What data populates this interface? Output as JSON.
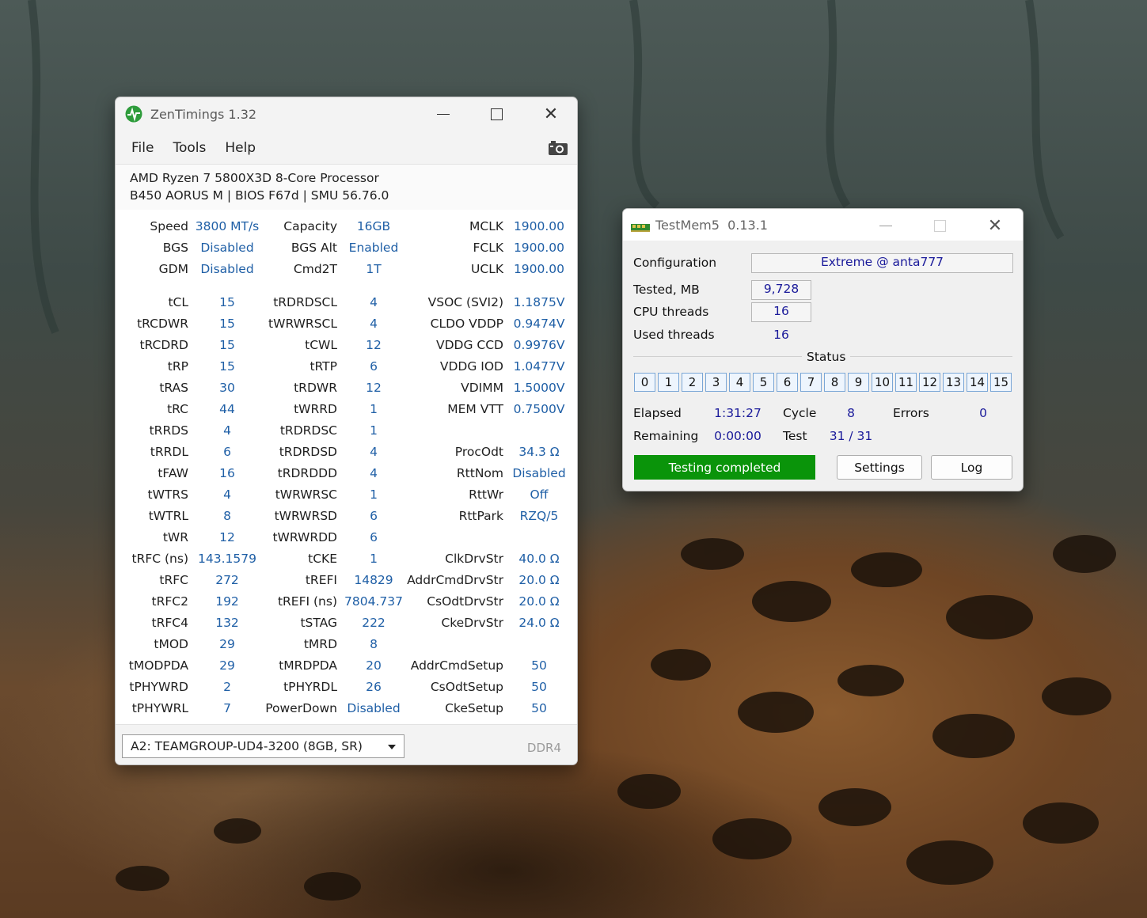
{
  "zentimings": {
    "title": "ZenTimings 1.32",
    "menu": [
      "File",
      "Tools",
      "Help"
    ],
    "cpu": "AMD Ryzen 7 5800X3D 8-Core Processor",
    "board": "B450 AORUS M | BIOS F67d | SMU 56.76.0",
    "col1": [
      {
        "label": "Speed",
        "value": "3800 MT/s"
      },
      {
        "label": "BGS",
        "value": "Disabled"
      },
      {
        "label": "GDM",
        "value": "Disabled"
      },
      null,
      {
        "label": "tCL",
        "value": "15"
      },
      {
        "label": "tRCDWR",
        "value": "15"
      },
      {
        "label": "tRCDRD",
        "value": "15"
      },
      {
        "label": "tRP",
        "value": "15"
      },
      {
        "label": "tRAS",
        "value": "30"
      },
      {
        "label": "tRC",
        "value": "44"
      },
      {
        "label": "tRRDS",
        "value": "4"
      },
      {
        "label": "tRRDL",
        "value": "6"
      },
      {
        "label": "tFAW",
        "value": "16"
      },
      {
        "label": "tWTRS",
        "value": "4"
      },
      {
        "label": "tWTRL",
        "value": "8"
      },
      {
        "label": "tWR",
        "value": "12"
      },
      {
        "label": "tRFC (ns)",
        "value": "143.1579"
      },
      {
        "label": "tRFC",
        "value": "272"
      },
      {
        "label": "tRFC2",
        "value": "192"
      },
      {
        "label": "tRFC4",
        "value": "132"
      },
      {
        "label": "tMOD",
        "value": "29"
      },
      {
        "label": "tMODPDA",
        "value": "29"
      },
      {
        "label": "tPHYWRD",
        "value": "2"
      },
      {
        "label": "tPHYWRL",
        "value": "7"
      }
    ],
    "col2": [
      {
        "label": "Capacity",
        "value": "16GB"
      },
      {
        "label": "BGS Alt",
        "value": "Enabled"
      },
      {
        "label": "Cmd2T",
        "value": "1T"
      },
      null,
      {
        "label": "tRDRDSCL",
        "value": "4"
      },
      {
        "label": "tWRWRSCL",
        "value": "4"
      },
      {
        "label": "tCWL",
        "value": "12"
      },
      {
        "label": "tRTP",
        "value": "6"
      },
      {
        "label": "tRDWR",
        "value": "12"
      },
      {
        "label": "tWRRD",
        "value": "1"
      },
      {
        "label": "tRDRDSC",
        "value": "1"
      },
      {
        "label": "tRDRDSD",
        "value": "4"
      },
      {
        "label": "tRDRDDD",
        "value": "4"
      },
      {
        "label": "tWRWRSC",
        "value": "1"
      },
      {
        "label": "tWRWRSD",
        "value": "6"
      },
      {
        "label": "tWRWRDD",
        "value": "6"
      },
      {
        "label": "tCKE",
        "value": "1"
      },
      {
        "label": "tREFI",
        "value": "14829"
      },
      {
        "label": "tREFI (ns)",
        "value": "7804.737"
      },
      {
        "label": "tSTAG",
        "value": "222"
      },
      {
        "label": "tMRD",
        "value": "8"
      },
      {
        "label": "tMRDPDA",
        "value": "20"
      },
      {
        "label": "tPHYRDL",
        "value": "26"
      },
      {
        "label": "PowerDown",
        "value": "Disabled"
      }
    ],
    "col3": [
      {
        "label": "MCLK",
        "value": "1900.00"
      },
      {
        "label": "FCLK",
        "value": "1900.00"
      },
      {
        "label": "UCLK",
        "value": "1900.00"
      },
      null,
      {
        "label": "VSOC (SVI2)",
        "value": "1.1875V"
      },
      {
        "label": "CLDO VDDP",
        "value": "0.9474V"
      },
      {
        "label": "VDDG CCD",
        "value": "0.9976V"
      },
      {
        "label": "VDDG IOD",
        "value": "1.0477V"
      },
      {
        "label": "VDIMM",
        "value": "1.5000V"
      },
      {
        "label": "MEM VTT",
        "value": "0.7500V"
      },
      null,
      {
        "label": "ProcOdt",
        "value": "34.3 Ω"
      },
      {
        "label": "RttNom",
        "value": "Disabled"
      },
      {
        "label": "RttWr",
        "value": "Off"
      },
      {
        "label": "RttPark",
        "value": "RZQ/5"
      },
      null,
      {
        "label": "ClkDrvStr",
        "value": "40.0 Ω"
      },
      {
        "label": "AddrCmdDrvStr",
        "value": "20.0 Ω"
      },
      {
        "label": "CsOdtDrvStr",
        "value": "20.0 Ω"
      },
      {
        "label": "CkeDrvStr",
        "value": "24.0 Ω"
      },
      null,
      {
        "label": "AddrCmdSetup",
        "value": "50"
      },
      {
        "label": "CsOdtSetup",
        "value": "50"
      },
      {
        "label": "CkeSetup",
        "value": "50"
      }
    ],
    "module": "A2: TEAMGROUP-UD4-3200 (8GB, SR)",
    "mem_type": "DDR4"
  },
  "testmem": {
    "title": "TestMem5  0.13.1",
    "configuration_label": "Configuration",
    "configuration_value": "Extreme @ anta777",
    "tested_label": "Tested, MB",
    "tested_value": "9,728",
    "cpu_threads_label": "CPU threads",
    "cpu_threads_value": "16",
    "used_threads_label": "Used threads",
    "used_threads_value": "16",
    "status_label": "Status",
    "threads": [
      "0",
      "1",
      "2",
      "3",
      "4",
      "5",
      "6",
      "7",
      "8",
      "9",
      "10",
      "11",
      "12",
      "13",
      "14",
      "15"
    ],
    "elapsed_label": "Elapsed",
    "elapsed_value": "1:31:27",
    "cycle_label": "Cycle",
    "cycle_value": "8",
    "errors_label": "Errors",
    "errors_value": "0",
    "remaining_label": "Remaining",
    "remaining_value": "0:00:00",
    "test_label": "Test",
    "test_value": "31 / 31",
    "progress_text": "Testing completed",
    "progress_color": "#0a940a",
    "settings_label": "Settings",
    "log_label": "Log"
  }
}
